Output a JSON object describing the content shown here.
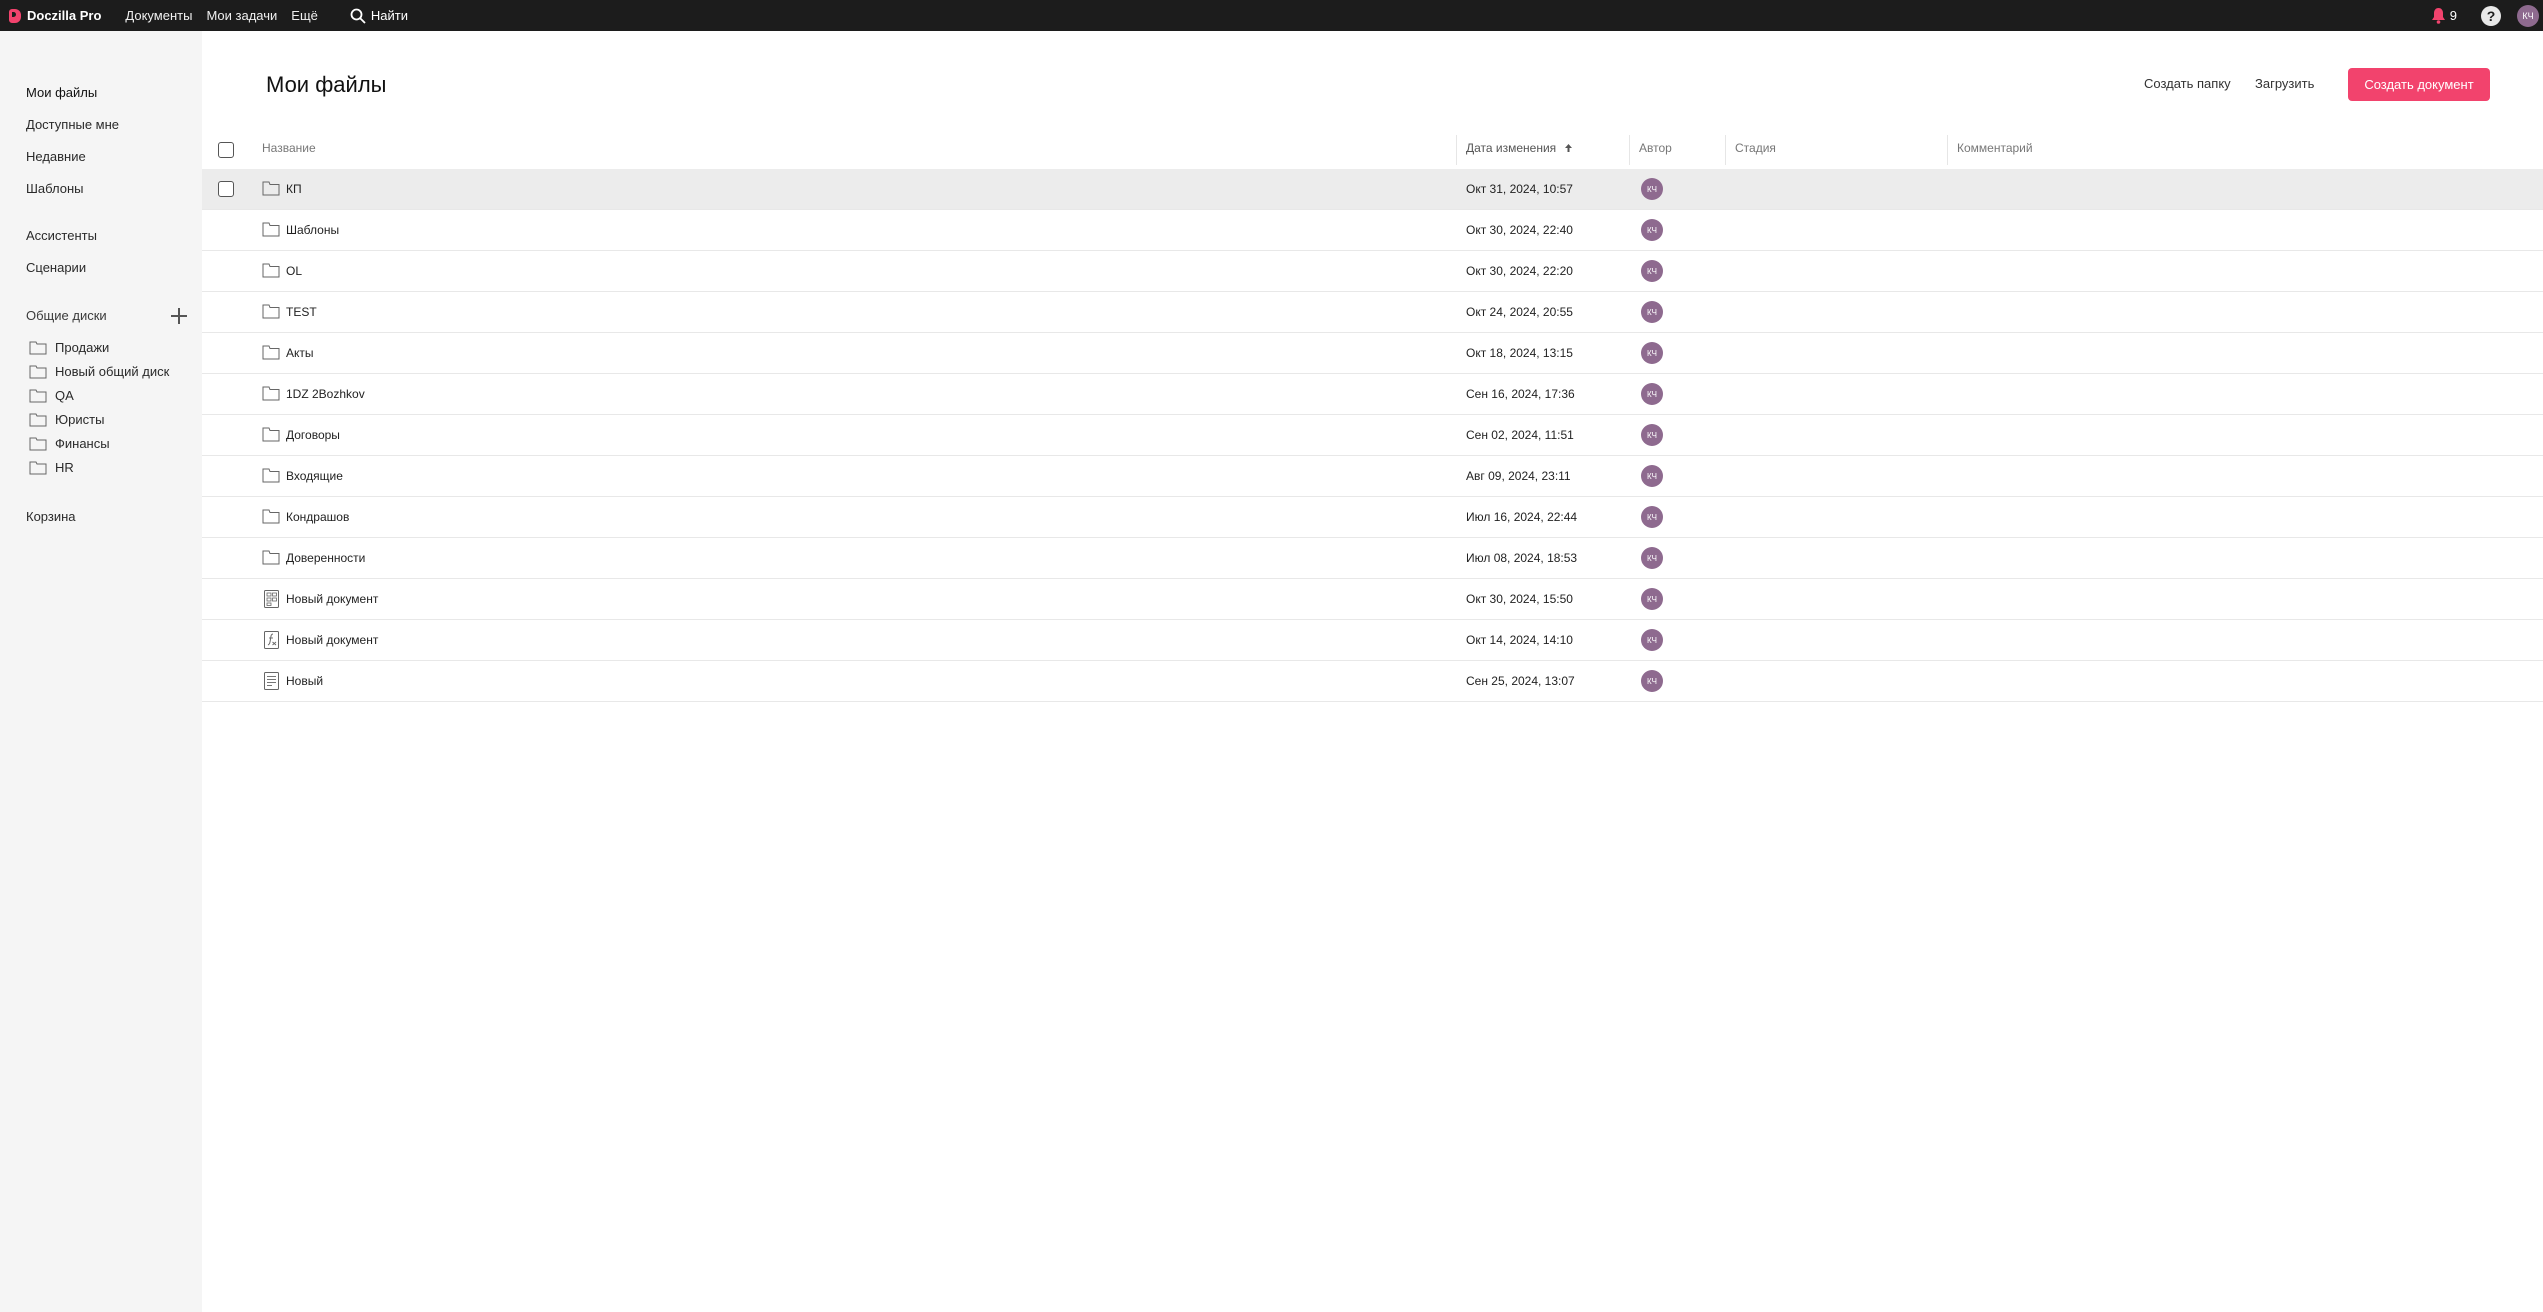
{
  "app": {
    "name": "Doczilla Pro"
  },
  "topbar": {
    "nav": [
      "Документы",
      "Мои задачи",
      "Ещё"
    ],
    "search_label": "Найти",
    "notifications_count": "9",
    "help_label": "?",
    "user_initials": "КЧ"
  },
  "sidebar": {
    "items": [
      "Мои файлы",
      "Доступные мне",
      "Недавние",
      "Шаблоны"
    ],
    "items2": [
      "Ассистенты",
      "Сценарии"
    ],
    "shared_title": "Общие диски",
    "shared_disks": [
      "Продажи",
      "Новый общий диск",
      "QA",
      "Юристы",
      "Финансы",
      "HR"
    ],
    "trash": "Корзина"
  },
  "main": {
    "title": "Мои файлы",
    "create_folder": "Создать папку",
    "upload": "Загрузить",
    "create_document": "Создать документ"
  },
  "table": {
    "columns": {
      "name": "Название",
      "modified": "Дата изменения",
      "sort_icon": "arrow-up-icon",
      "author": "Автор",
      "stage": "Стадия",
      "comment": "Комментарий"
    },
    "rows": [
      {
        "name": "КП",
        "date": "Окт 31, 2024, 10:57",
        "author": "КЧ",
        "type": "folder"
      },
      {
        "name": "Шаблоны",
        "date": "Окт 30, 2024, 22:40",
        "author": "КЧ",
        "type": "folder"
      },
      {
        "name": "OL",
        "date": "Окт 30, 2024, 22:20",
        "author": "КЧ",
        "type": "folder"
      },
      {
        "name": "TEST",
        "date": "Окт 24, 2024, 20:55",
        "author": "КЧ",
        "type": "folder"
      },
      {
        "name": "Акты",
        "date": "Окт 18, 2024, 13:15",
        "author": "КЧ",
        "type": "folder"
      },
      {
        "name": "1DZ 2Bozhkov",
        "date": "Сен 16, 2024, 17:36",
        "author": "КЧ",
        "type": "folder"
      },
      {
        "name": "Договоры",
        "date": "Сен 02, 2024, 11:51",
        "author": "КЧ",
        "type": "folder"
      },
      {
        "name": "Входящие",
        "date": "Авг 09, 2024, 23:11",
        "author": "КЧ",
        "type": "folder"
      },
      {
        "name": "Кондрашов",
        "date": "Июл 16, 2024, 22:44",
        "author": "КЧ",
        "type": "folder"
      },
      {
        "name": "Доверенности",
        "date": "Июл 08, 2024, 18:53",
        "author": "КЧ",
        "type": "folder"
      },
      {
        "name": "Новый документ",
        "date": "Окт 30, 2024, 15:50",
        "author": "КЧ",
        "type": "form"
      },
      {
        "name": "Новый документ",
        "date": "Окт 14, 2024, 14:10",
        "author": "КЧ",
        "type": "formula"
      },
      {
        "name": "Новый",
        "date": "Сен 25, 2024, 13:07",
        "author": "КЧ",
        "type": "doc"
      }
    ]
  }
}
